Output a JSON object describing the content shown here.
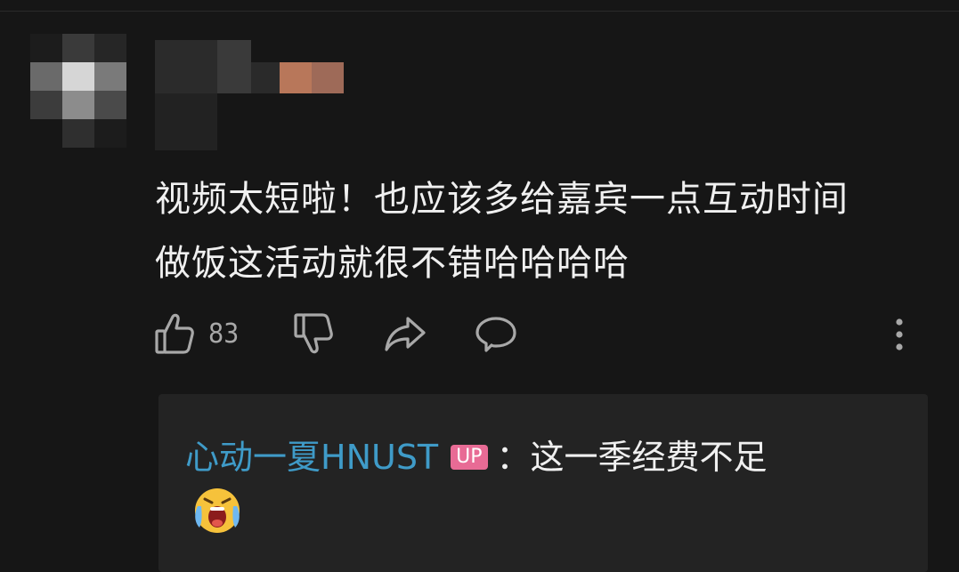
{
  "comment": {
    "text_line1": "视频太短啦！也应该多给嘉宾一点互动时间",
    "text_line2": "做饭这活动就很不错哈哈哈哈",
    "like_count": "83"
  },
  "actions": {
    "like_icon": "thumbs-up-icon",
    "dislike_icon": "thumbs-down-icon",
    "share_icon": "share-arrow-icon",
    "reply_icon": "speech-bubble-icon",
    "more_icon": "more-vertical-icon"
  },
  "reply": {
    "author": "心动一夏HNUST",
    "badge": "UP",
    "separator": "：",
    "text": "这一季经费不足",
    "emoji": "crying-face-emoji"
  },
  "colors": {
    "background": "#161616",
    "reply_background": "#232323",
    "author_blue": "#3f9bc8",
    "up_badge_pink": "#e86b95",
    "icon_gray": "#a8a8a8"
  }
}
